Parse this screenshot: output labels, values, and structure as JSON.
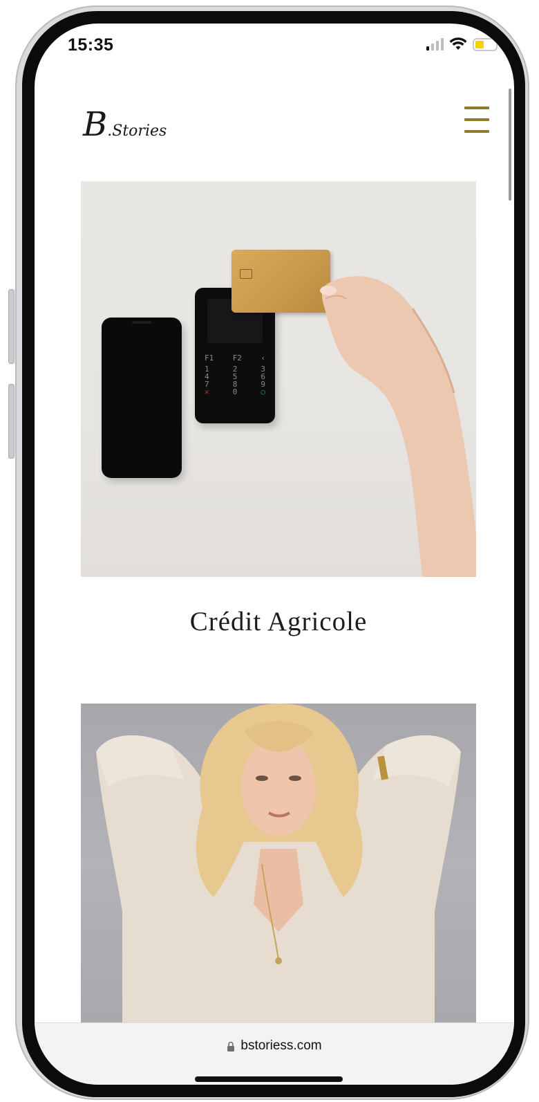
{
  "status_bar": {
    "time": "15:35",
    "icons": [
      "signal-icon",
      "wifi-icon",
      "battery-icon"
    ],
    "battery_color": "#f5d300"
  },
  "header": {
    "logo_initial": "B",
    "logo_rest": ".Stories",
    "menu_icon": "hamburger-menu-icon",
    "menu_color": "#8d7a2d"
  },
  "projects": [
    {
      "title": "Crédit Agricole"
    },
    {
      "title": ""
    }
  ],
  "browser": {
    "url": "bstoriess.com",
    "icon": "lock-icon"
  }
}
